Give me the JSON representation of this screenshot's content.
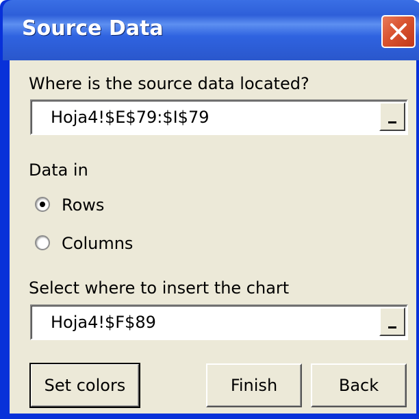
{
  "window": {
    "title": "Source Data",
    "close_icon": "close-icon"
  },
  "source": {
    "label": "Where is the source data located?",
    "value": "Hoja4!$E$79:$I$79"
  },
  "data_in": {
    "label": "Data in",
    "options": [
      {
        "label": "Rows",
        "selected": true
      },
      {
        "label": "Columns",
        "selected": false
      }
    ]
  },
  "insert": {
    "label": "Select where to insert the chart",
    "value": "Hoja4!$F$89"
  },
  "buttons": {
    "set_colors": "Set colors",
    "finish": "Finish",
    "back": "Back"
  },
  "colors": {
    "titlebar": "#2a57cc",
    "client": "#ece9d8",
    "close": "#d9532f"
  }
}
